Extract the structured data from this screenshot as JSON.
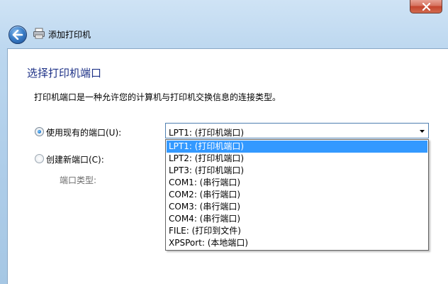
{
  "window": {
    "title": "添加打印机",
    "close_icon": "close-icon",
    "back_icon": "back-arrow-icon",
    "app_icon": "printer-icon"
  },
  "page": {
    "heading": "选择打印机端口",
    "description": "打印机端口是一种允许您的计算机与打印机交换信息的连接类型。"
  },
  "options": {
    "use_existing": {
      "label": "使用现有的端口(U):",
      "selected": true
    },
    "create_new": {
      "label": "创建新端口(C):",
      "selected": false
    },
    "port_type_label": "端口类型:"
  },
  "port_select": {
    "value": "LPT1: (打印机端口)",
    "items": [
      "LPT1: (打印机端口)",
      "LPT2: (打印机端口)",
      "LPT3: (打印机端口)",
      "COM1: (串行端口)",
      "COM2: (串行端口)",
      "COM3: (串行端口)",
      "COM4: (串行端口)",
      "FILE: (打印到文件)",
      "XPSPort: (本地端口)"
    ],
    "selected_index": 0
  },
  "colors": {
    "heading": "#1e3287",
    "selection": "#3399ff",
    "frame": "#aecde9"
  }
}
